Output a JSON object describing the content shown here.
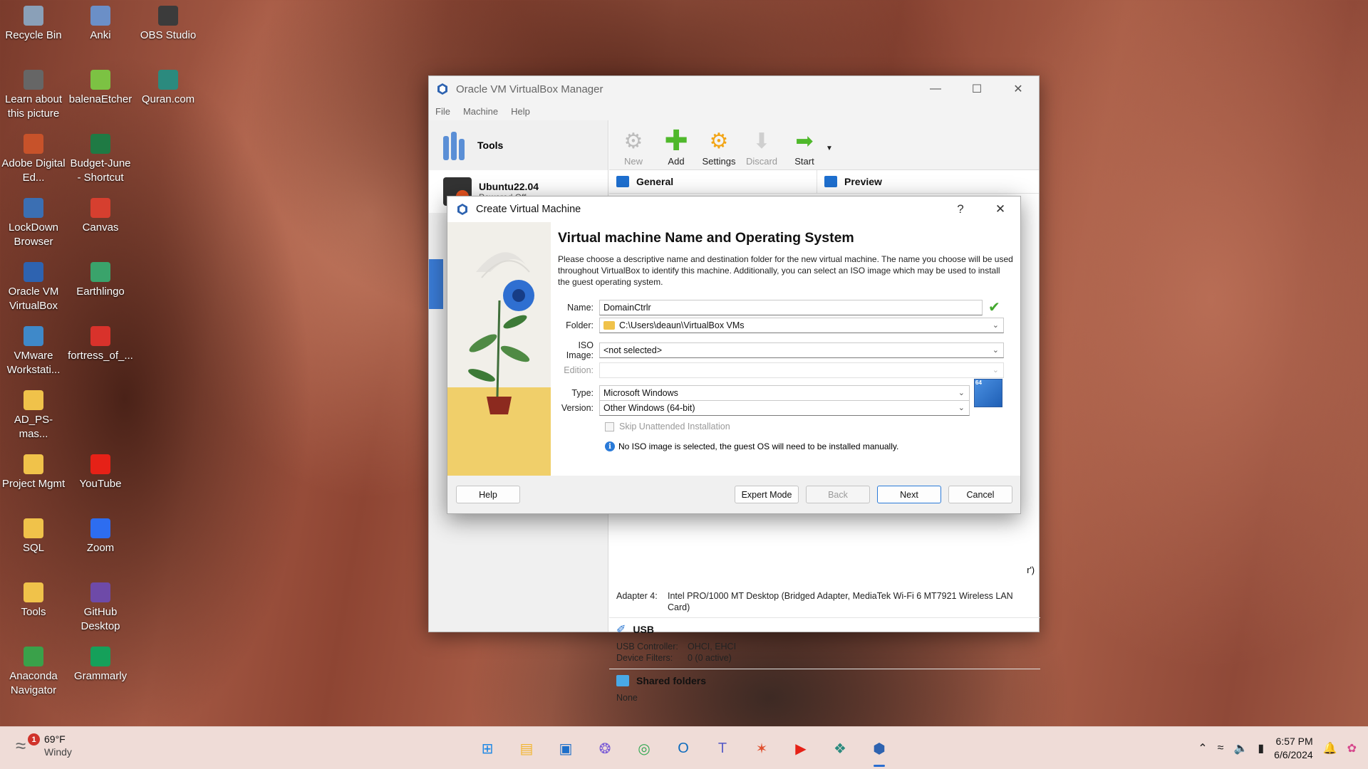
{
  "desktop": {
    "icons": [
      {
        "label": "Recycle Bin",
        "icon": "recycle-bin-icon",
        "color": "#8aa0b8"
      },
      {
        "label": "Anki",
        "icon": "anki-icon",
        "color": "#6b8fc7"
      },
      {
        "label": "OBS Studio",
        "icon": "obs-icon",
        "color": "#3b3b3b"
      },
      {
        "label": "Learn about this picture",
        "icon": "camera-icon",
        "color": "#666666"
      },
      {
        "label": "balenaEtcher",
        "icon": "etcher-icon",
        "color": "#7cc243"
      },
      {
        "label": "Quran.com",
        "icon": "quran-icon",
        "color": "#2b8a7e"
      },
      {
        "label": "Adobe Digital Ed...",
        "icon": "adobe-icon",
        "color": "#c7522a"
      },
      {
        "label": "Budget-June - Shortcut",
        "icon": "excel-icon",
        "color": "#1f7a44"
      },
      {
        "label": "LockDown Browser",
        "icon": "lockdown-icon",
        "color": "#3b6fb3"
      },
      {
        "label": "Canvas",
        "icon": "canvas-icon",
        "color": "#d63f2f"
      },
      {
        "label": "Oracle VM VirtualBox",
        "icon": "virtualbox-icon",
        "color": "#2e63b0"
      },
      {
        "label": "Earthlingo",
        "icon": "earthlingo-icon",
        "color": "#3aa36b"
      },
      {
        "label": "VMware Workstati...",
        "icon": "vmware-icon",
        "color": "#3f89c9"
      },
      {
        "label": "fortress_of_...",
        "icon": "pdf-icon",
        "color": "#d9322b"
      },
      {
        "label": "AD_PS-mas...",
        "icon": "folder-icon",
        "color": "#f0c24a"
      },
      {
        "label": "Project Mgmt",
        "icon": "folder-icon",
        "color": "#f0c24a"
      },
      {
        "label": "YouTube",
        "icon": "youtube-icon",
        "color": "#e62117"
      },
      {
        "label": "SQL",
        "icon": "folder-icon",
        "color": "#f0c24a"
      },
      {
        "label": "Zoom",
        "icon": "zoom-icon",
        "color": "#2d6df0"
      },
      {
        "label": "Tools",
        "icon": "folder-icon",
        "color": "#f0c24a"
      },
      {
        "label": "GitHub Desktop",
        "icon": "github-icon",
        "color": "#6e4aa8"
      },
      {
        "label": "Anaconda Navigator",
        "icon": "anaconda-icon",
        "color": "#3aa14a"
      },
      {
        "label": "Grammarly",
        "icon": "grammarly-icon",
        "color": "#15a05a"
      }
    ]
  },
  "manager": {
    "title": "Oracle VM VirtualBox Manager",
    "menu": [
      "File",
      "Machine",
      "Help"
    ],
    "tools_label": "Tools",
    "vm_name": "Ubuntu22.04",
    "vm_state": "Powered Off",
    "toolbar": [
      {
        "label": "New",
        "icon": "new-gear-icon",
        "enabled": false
      },
      {
        "label": "Add",
        "icon": "add-plus-icon",
        "enabled": true
      },
      {
        "label": "Settings",
        "icon": "settings-gear-icon",
        "enabled": true
      },
      {
        "label": "Discard",
        "icon": "discard-arrow-icon",
        "enabled": false
      },
      {
        "label": "Start",
        "icon": "start-arrow-icon",
        "enabled": true
      }
    ],
    "sections": {
      "general": "General",
      "preview": "Preview",
      "usb": "USB",
      "shared": "Shared folders"
    },
    "network_tail": "r')",
    "adapter4": {
      "key": "Adapter 4:",
      "value": "Intel PRO/1000 MT Desktop (Bridged Adapter, MediaTek Wi-Fi 6 MT7921 Wireless LAN Card)"
    },
    "usb_rows": [
      {
        "key": "USB Controller:",
        "value": "OHCI, EHCI"
      },
      {
        "key": "Device Filters:",
        "value": "0 (0 active)"
      }
    ],
    "shared_value": "None"
  },
  "dialog": {
    "title": "Create Virtual Machine",
    "help_glyph": "?",
    "heading": "Virtual machine Name and Operating System",
    "description": "Please choose a descriptive name and destination folder for the new virtual machine. The name you choose will be used throughout VirtualBox to identify this machine. Additionally, you can select an ISO image which may be used to install the guest operating system.",
    "fields": {
      "name_label": "Name:",
      "name_value": "DomainCtrlr",
      "folder_label": "Folder:",
      "folder_value": "C:\\Users\\deaun\\VirtualBox VMs",
      "iso_label": "ISO Image:",
      "iso_value": "<not selected>",
      "edition_label": "Edition:",
      "type_label": "Type:",
      "type_value": "Microsoft Windows",
      "version_label": "Version:",
      "version_value": "Other Windows (64-bit)",
      "os_badge": "64"
    },
    "skip_unattended": "Skip Unattended Installation",
    "info_text": "No ISO image is selected, the guest OS will need to be installed manually.",
    "buttons": {
      "help": "Help",
      "expert": "Expert Mode",
      "back": "Back",
      "next": "Next",
      "cancel": "Cancel"
    }
  },
  "taskbar": {
    "weather_temp": "69°F",
    "weather_desc": "Windy",
    "weather_badge": "1",
    "apps": [
      {
        "icon": "windows-start-icon",
        "color": "#1e88e5"
      },
      {
        "icon": "file-explorer-icon",
        "color": "#f2b632"
      },
      {
        "icon": "remote-desktop-icon",
        "color": "#1d6fc9"
      },
      {
        "icon": "copilot-icon",
        "color": "#7b5cd6"
      },
      {
        "icon": "chrome-icon",
        "color": "#34a853"
      },
      {
        "icon": "outlook-icon",
        "color": "#0f6cbd"
      },
      {
        "icon": "teams-icon",
        "color": "#5b5fc7"
      },
      {
        "icon": "app-red-icon",
        "color": "#e0502f"
      },
      {
        "icon": "youtube-icon",
        "color": "#e62117"
      },
      {
        "icon": "quran-icon",
        "color": "#2b8a7e"
      },
      {
        "icon": "virtualbox-icon",
        "color": "#2e63b0"
      }
    ],
    "time": "6:57 PM",
    "date": "6/6/2024"
  }
}
